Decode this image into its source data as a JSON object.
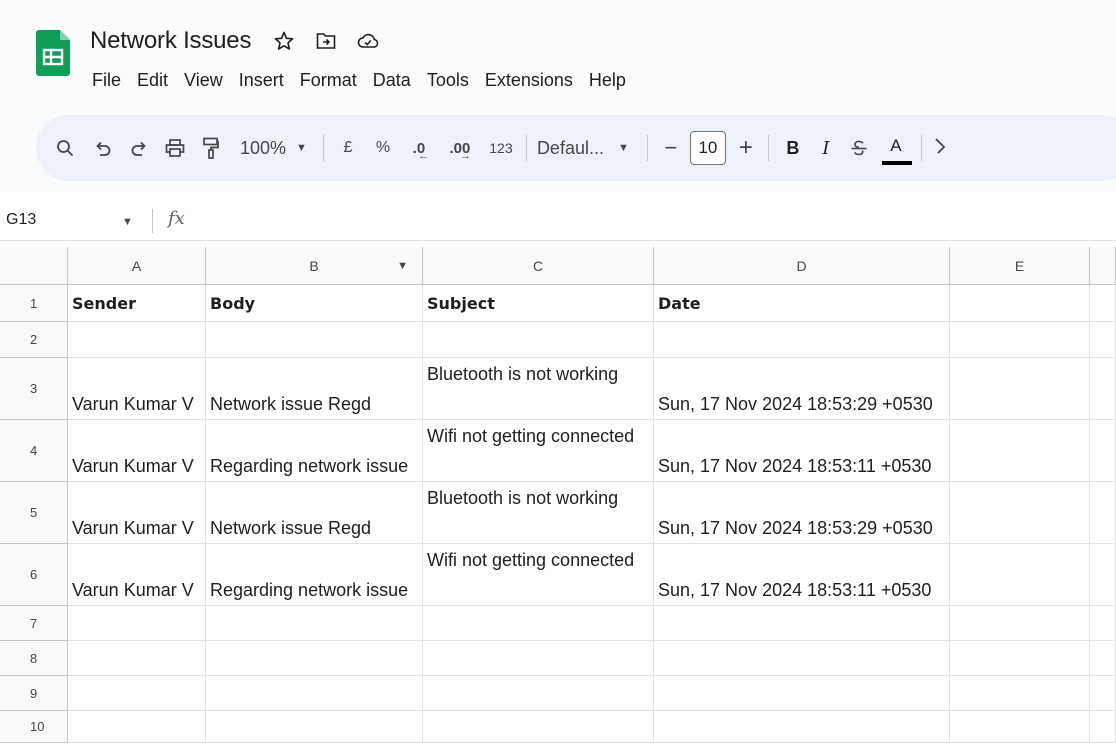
{
  "document": {
    "title": "Network Issues"
  },
  "title_icons": [
    "star-icon",
    "move-to-folder-icon",
    "cloud-status-icon"
  ],
  "menu": [
    "File",
    "Edit",
    "View",
    "Insert",
    "Format",
    "Data",
    "Tools",
    "Extensions",
    "Help"
  ],
  "toolbar": {
    "zoom": "100%",
    "currency": "£",
    "percent": "%",
    "decrease_decimal": ".0",
    "increase_decimal": ".00",
    "number_format": "123",
    "font": "Defaul...",
    "minus": "−",
    "font_size": "10",
    "plus": "+",
    "bold": "B",
    "italic": "I",
    "text_color": "A"
  },
  "formula_bar": {
    "cell_ref": "G13",
    "fx": "fx"
  },
  "columns": [
    "A",
    "B",
    "C",
    "D",
    "E"
  ],
  "rows": [
    {
      "num": "1",
      "cells": [
        "Sender",
        "Body",
        "Subject",
        "Date",
        ""
      ]
    },
    {
      "num": "2",
      "cells": [
        "",
        "",
        "",
        "",
        ""
      ]
    },
    {
      "num": "3",
      "cells": [
        "Varun Kumar V",
        "Network issue Regd",
        "Bluetooth is not working",
        "Sun, 17 Nov 2024 18:53:29 +0530",
        ""
      ]
    },
    {
      "num": "4",
      "cells": [
        "Varun Kumar V",
        "Regarding network issue",
        "Wifi not getting connected",
        "Sun, 17 Nov 2024 18:53:11 +0530",
        ""
      ]
    },
    {
      "num": "5",
      "cells": [
        "Varun Kumar V",
        "Network issue Regd",
        "Bluetooth is not working",
        "Sun, 17 Nov 2024 18:53:29 +0530",
        ""
      ]
    },
    {
      "num": "6",
      "cells": [
        "Varun Kumar V",
        "Regarding network issue",
        "Wifi not getting connected",
        "Sun, 17 Nov 2024 18:53:11 +0530",
        ""
      ]
    },
    {
      "num": "7",
      "cells": [
        "",
        "",
        "",
        "",
        ""
      ]
    },
    {
      "num": "8",
      "cells": [
        "",
        "",
        "",
        "",
        ""
      ]
    },
    {
      "num": "9",
      "cells": [
        "",
        "",
        "",
        "",
        ""
      ]
    },
    {
      "num": "10",
      "cells": [
        "",
        "",
        "",
        "",
        ""
      ]
    }
  ],
  "colors": {
    "sheets_green": "#0f9d58",
    "toolbar_bg": "#edf2fa",
    "header_bg": "#f8f9fa"
  }
}
